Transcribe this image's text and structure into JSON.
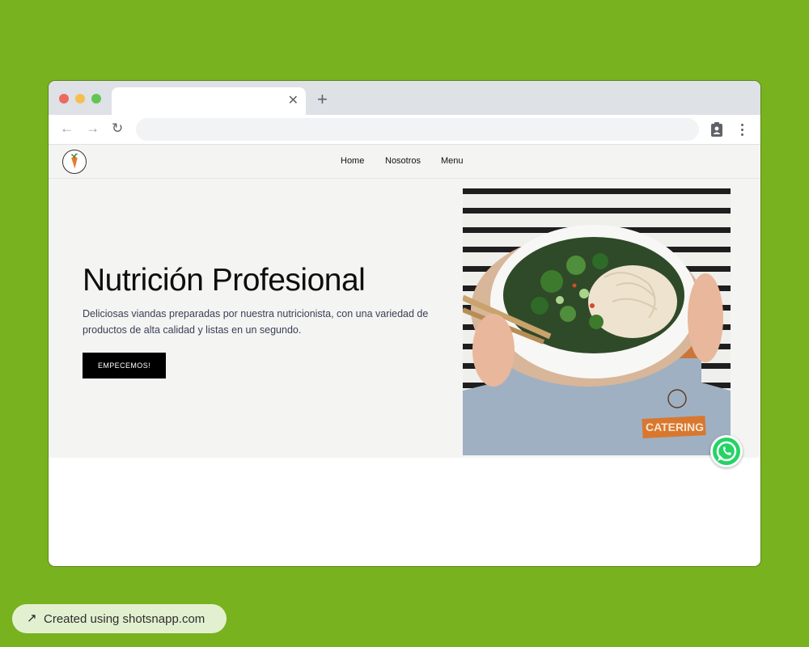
{
  "browser": {
    "tab_close": "✕",
    "new_tab": "+",
    "back": "←",
    "forward": "→",
    "reload": "↻",
    "address_value": "",
    "address_placeholder": ""
  },
  "site": {
    "nav": {
      "home": "Home",
      "about": "Nosotros",
      "menu": "Menu"
    },
    "hero": {
      "title": "Nutrición Profesional",
      "description": "Deliciosas viandas preparadas por nuestra nutricionista, con una variedad de productos de alta calidad y listas en un segundo.",
      "cta_label": "EMPECEMOS!",
      "image_badge": "CATERING"
    }
  },
  "colors": {
    "background": "#78b21f",
    "hero_bg": "#f4f4f3",
    "cta_bg": "#000000",
    "badge_orange": "#d9772e",
    "whatsapp": "#25d366"
  },
  "icons": [
    "close-icon",
    "plus-icon",
    "back-arrow-icon",
    "forward-arrow-icon",
    "reload-icon",
    "clipboard-icon",
    "more-vert-icon",
    "carrot-logo-icon",
    "whatsapp-icon",
    "external-link-icon"
  ],
  "footer": {
    "arrow": "↗",
    "label": "Created using shotsnapp.com"
  }
}
